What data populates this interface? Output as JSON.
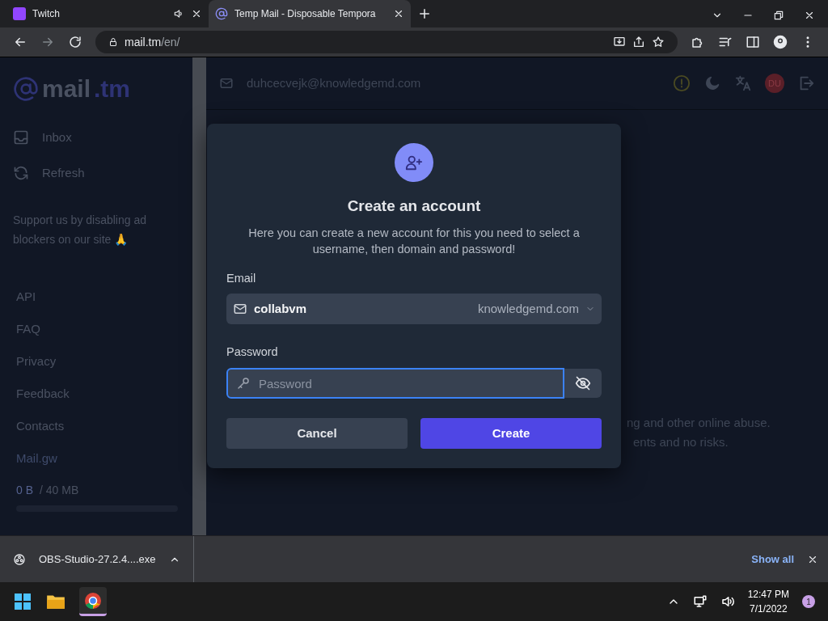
{
  "browser": {
    "tabs": [
      {
        "title": "Twitch",
        "selected": false,
        "audio": true
      },
      {
        "title": "Temp Mail - Disposable Tempora",
        "selected": true,
        "audio": false
      }
    ],
    "address": {
      "host": "mail.tm",
      "path": "/en/"
    }
  },
  "sidebar": {
    "logo": {
      "name": "mail",
      "accent": ".tm"
    },
    "nav": [
      {
        "label": "Inbox",
        "kind": "inbox"
      },
      {
        "label": "Refresh",
        "kind": "refresh"
      }
    ],
    "support_note": "Support us by disabling ad blockers on our site 🙏",
    "links": [
      "API",
      "FAQ",
      "Privacy",
      "Feedback",
      "Contacts",
      "Mail.gw"
    ],
    "storage": {
      "used": "0 B",
      "total": "/ 40 MB",
      "level": 0
    }
  },
  "header": {
    "email": "duhcecvejk@knowledgemd.com",
    "avatar": "DU"
  },
  "background_text": [
    "ng and other online abuse.",
    "ents and no risks."
  ],
  "modal": {
    "title": "Create an account",
    "description": "Here you can create a new account for this you need to select a username, then domain and password!",
    "email_label": "Email",
    "username": "collabvm",
    "domain": "knowledgemd.com",
    "password_label": "Password",
    "password_placeholder": "Password",
    "buttons": [
      {
        "label": "Cancel",
        "kind": "secondary"
      },
      {
        "label": "Create",
        "kind": "primary"
      }
    ]
  },
  "downloads": {
    "file": "OBS-Studio-27.2.4....exe",
    "show_all": "Show all"
  },
  "taskbar": {
    "time": "12:47 PM",
    "date": "7/1/2022",
    "notifications": "1"
  }
}
